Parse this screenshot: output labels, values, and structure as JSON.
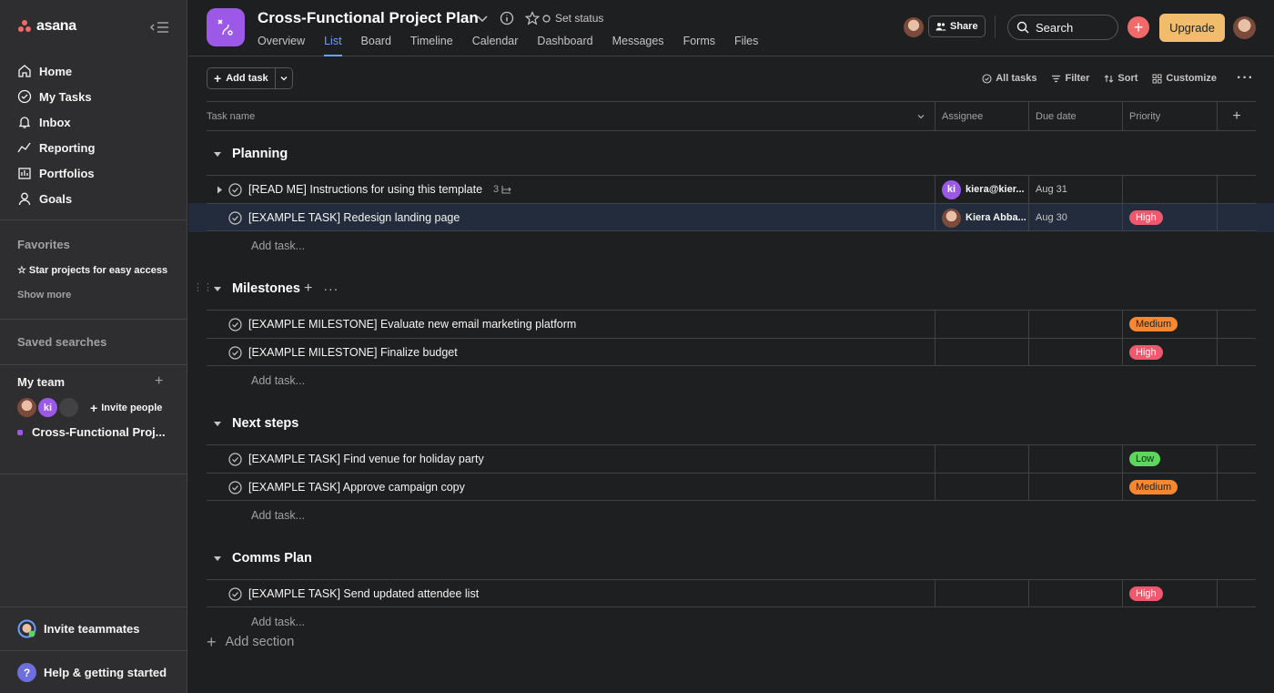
{
  "app": {
    "name": "asana"
  },
  "sidebar": {
    "nav": [
      {
        "label": "Home",
        "icon": "home-icon"
      },
      {
        "label": "My Tasks",
        "icon": "check-circle-icon"
      },
      {
        "label": "Inbox",
        "icon": "bell-icon"
      },
      {
        "label": "Reporting",
        "icon": "trend-icon"
      },
      {
        "label": "Portfolios",
        "icon": "portfolio-icon"
      },
      {
        "label": "Goals",
        "icon": "person-icon"
      }
    ],
    "favorites_title": "Favorites",
    "favorites_hint": "Star projects for easy access",
    "show_more": "Show more",
    "saved_searches": "Saved searches",
    "team_title": "My team",
    "team_avatar_initials": "ki",
    "invite_people": "Invite people",
    "project_link": "Cross-Functional Proj...",
    "invite_teammates": "Invite teammates",
    "help": "Help & getting started"
  },
  "header": {
    "project_title": "Cross-Functional Project Plan",
    "set_status": "Set status",
    "tabs": [
      "Overview",
      "List",
      "Board",
      "Timeline",
      "Calendar",
      "Dashboard",
      "Messages",
      "Forms",
      "Files"
    ],
    "active_tab": "List",
    "share": "Share",
    "search_placeholder": "Search",
    "upgrade": "Upgrade"
  },
  "toolbar": {
    "add_task": "Add task",
    "all_tasks": "All tasks",
    "filter": "Filter",
    "sort": "Sort",
    "customize": "Customize"
  },
  "columns": {
    "task_name": "Task name",
    "assignee": "Assignee",
    "due_date": "Due date",
    "priority": "Priority"
  },
  "sections": [
    {
      "name": "Planning",
      "tasks": [
        {
          "name": "[READ ME] Instructions for using this template",
          "subtasks": "3",
          "assignee": "kiera@kier...",
          "assignee_initials": "ki",
          "due": "Aug 31",
          "priority": ""
        },
        {
          "name": "[EXAMPLE TASK] Redesign landing page",
          "assignee": "Kiera Abba...",
          "due": "Aug 30",
          "priority": "High"
        }
      ],
      "add_task": "Add task..."
    },
    {
      "name": "Milestones",
      "tasks": [
        {
          "name": "[EXAMPLE MILESTONE] Evaluate new email marketing platform",
          "priority": "Medium"
        },
        {
          "name": "[EXAMPLE MILESTONE] Finalize budget",
          "priority": "High"
        }
      ],
      "add_task": "Add task..."
    },
    {
      "name": "Next steps",
      "tasks": [
        {
          "name": "[EXAMPLE TASK] Find venue for holiday party",
          "priority": "Low"
        },
        {
          "name": "[EXAMPLE TASK] Approve campaign copy",
          "priority": "Medium"
        }
      ],
      "add_task": "Add task..."
    },
    {
      "name": "Comms Plan",
      "tasks": [
        {
          "name": "[EXAMPLE TASK] Send updated attendee list",
          "priority": "High"
        }
      ],
      "add_task": "Add task..."
    }
  ],
  "add_section": "Add section",
  "colors": {
    "accent": "#6a9eff",
    "high": "#f0596d",
    "medium": "#f7882f",
    "low": "#5cd65c",
    "project": "#9c59e8",
    "upgrade": "#f1bd6c"
  }
}
